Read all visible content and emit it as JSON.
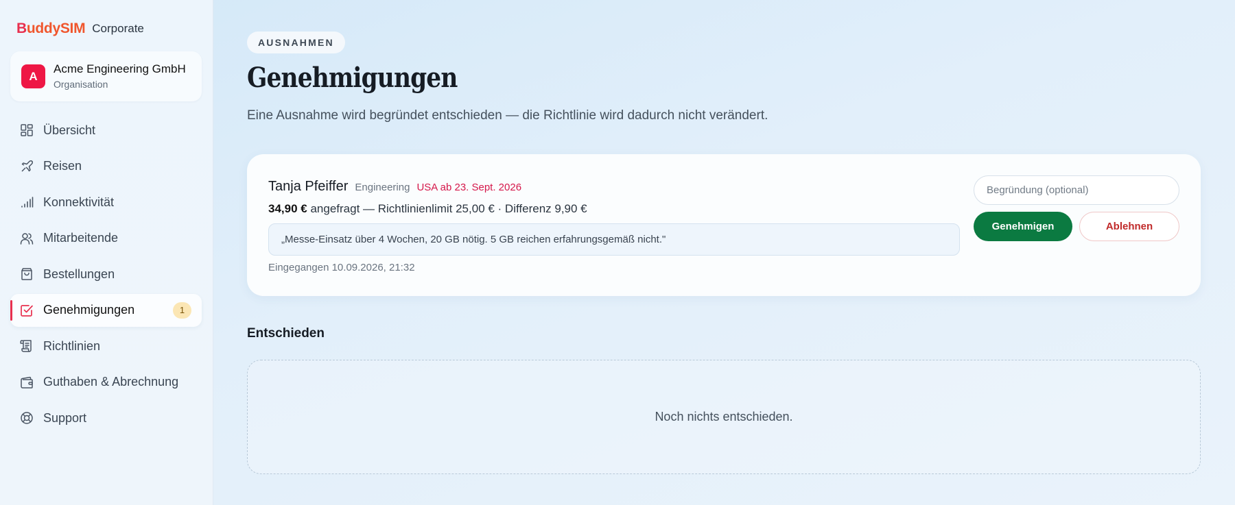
{
  "brand": {
    "name": "BuddySIM",
    "sub": "Corporate"
  },
  "org": {
    "initial": "A",
    "name": "Acme Engineering GmbH",
    "role": "Organisation"
  },
  "nav": [
    {
      "label": "Übersicht",
      "icon": "dashboard-icon"
    },
    {
      "label": "Reisen",
      "icon": "plane-icon"
    },
    {
      "label": "Konnektivität",
      "icon": "signal-icon"
    },
    {
      "label": "Mitarbeitende",
      "icon": "users-icon"
    },
    {
      "label": "Bestellungen",
      "icon": "bag-icon"
    },
    {
      "label": "Genehmigungen",
      "icon": "check-square-icon",
      "active": true,
      "badge": "1"
    },
    {
      "label": "Richtlinien",
      "icon": "scroll-icon"
    },
    {
      "label": "Guthaben & Abrechnung",
      "icon": "wallet-icon"
    },
    {
      "label": "Support",
      "icon": "lifebuoy-icon"
    }
  ],
  "header": {
    "eyebrow": "AUSNAHMEN",
    "title": "Genehmigungen",
    "subtitle": "Eine Ausnahme wird begründet entschieden — die Richtlinie wird dadurch nicht verändert."
  },
  "request": {
    "name": "Tanja Pfeiffer",
    "department": "Engineering",
    "destination": "USA ab 23. Sept. 2026",
    "amount": "34,90 €",
    "amount_rest": " angefragt — Richtlinienlimit 25,00 € · Differenz 9,90 €",
    "quote": "„Messe-Einsatz über 4 Wochen, 20 GB nötig. 5 GB reichen erfahrungsgemäß nicht.\"",
    "received": "Eingegangen 10.09.2026, 21:32",
    "reason_placeholder": "Begründung (optional)",
    "approve_label": "Genehmigen",
    "reject_label": "Ablehnen"
  },
  "decided": {
    "title": "Entschieden",
    "empty_text": "Noch nichts entschieden."
  },
  "colors": {
    "accent": "#e8304f",
    "approve": "#0b7a41",
    "reject": "#c02a2a"
  }
}
